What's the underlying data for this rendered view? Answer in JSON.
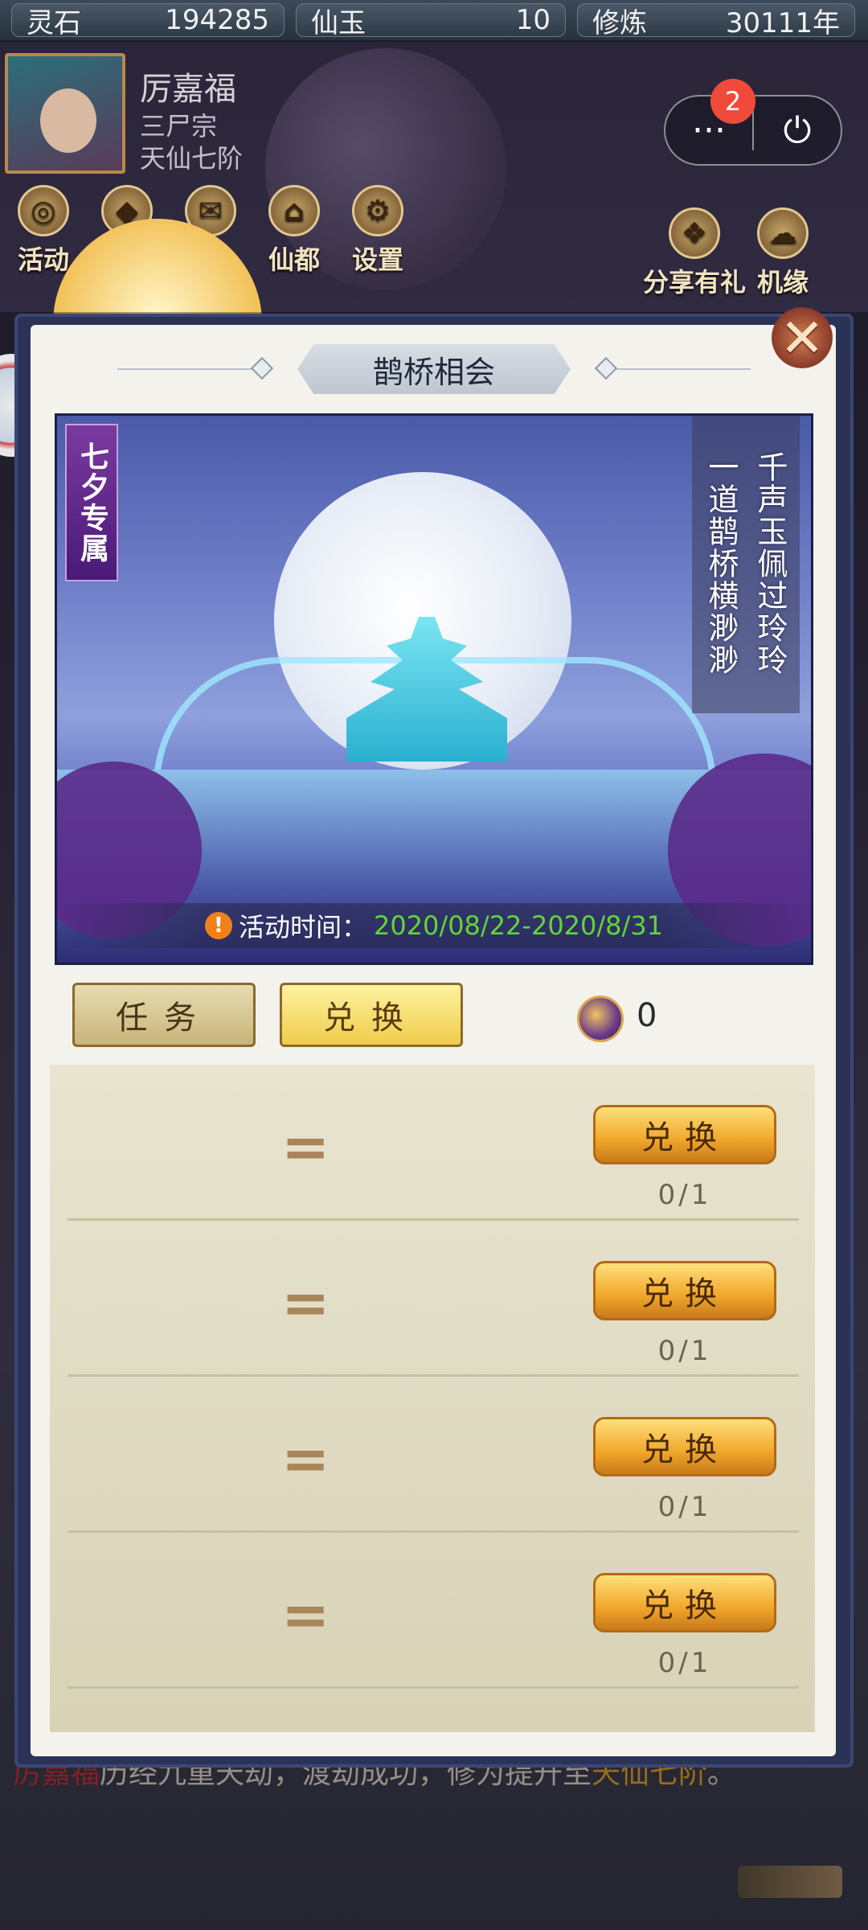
{
  "resources": [
    {
      "label": "灵石",
      "value": "194285"
    },
    {
      "label": "仙玉",
      "value": "10"
    },
    {
      "label": "修炼",
      "value": "30111年"
    }
  ],
  "player": {
    "name": "厉嘉福",
    "sect": "三尸宗",
    "rank": "天仙七阶"
  },
  "menu": {
    "notification_count": "2",
    "more_icon": "···",
    "power_icon": "⏻"
  },
  "game_icons": {
    "left": [
      {
        "label": "活动",
        "icon": "coin-icon"
      },
      {
        "label": "",
        "icon": "coin-icon"
      },
      {
        "label": "",
        "icon": "mail-icon"
      },
      {
        "label": "仙都",
        "icon": "palace-icon"
      },
      {
        "label": "设置",
        "icon": "gear-icon"
      }
    ],
    "right": [
      {
        "label": "分享有礼",
        "icon": "gift-icon"
      },
      {
        "label": "机缘",
        "icon": "cloud-icon"
      }
    ]
  },
  "log_text": {
    "name": "厉嘉福",
    "middle": "历经九重天劫，渡劫成功，修为提升至",
    "rank": "天仙七阶",
    "end": "。"
  },
  "modal": {
    "title": "鹊桥相会",
    "close_icon": "✕",
    "banner": {
      "tag": "七夕专属",
      "poem_line1": "千声玉佩过玲玲",
      "poem_line2": "一道鹊桥横渺渺",
      "time_label": "活动时间：",
      "time_value": "2020/08/22-2020/8/31",
      "warn_icon": "!"
    },
    "tabs": {
      "task": "任务",
      "exchange": "兑换"
    },
    "currency": {
      "icon": "magpie-coin-icon",
      "value": "0"
    },
    "rows": [
      {
        "eq": "=",
        "button": "兑换",
        "count": "0/1"
      },
      {
        "eq": "=",
        "button": "兑换",
        "count": "0/1"
      },
      {
        "eq": "=",
        "button": "兑换",
        "count": "0/1"
      },
      {
        "eq": "=",
        "button": "兑换",
        "count": "0/1"
      }
    ]
  }
}
